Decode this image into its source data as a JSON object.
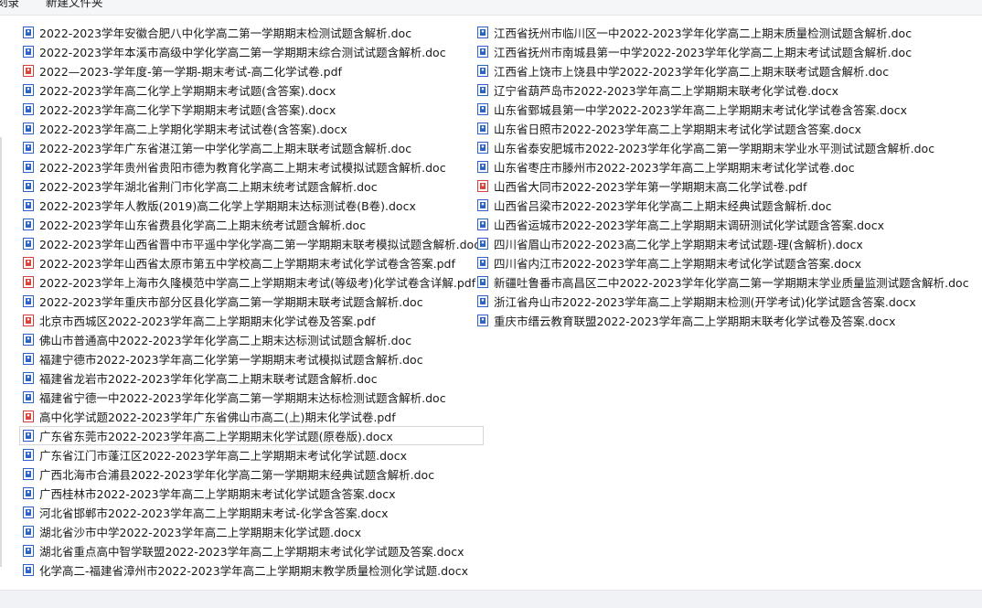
{
  "toolbar": {
    "items": [
      {
        "label": "刻录"
      },
      {
        "label": "新建文件夹"
      }
    ]
  },
  "files": {
    "left": [
      {
        "name": "2022-2023学年安徽合肥八中化学高二第一学期期末检测试题含解析.doc",
        "icon": "word-doc-icon"
      },
      {
        "name": "2022-2023学年本溪市高级中学化学高二第一学期期末综合测试试题含解析.doc",
        "icon": "word-doc-icon"
      },
      {
        "name": "2022—2023-学年度-第一学期-期末考试-高二化学试卷.pdf",
        "icon": "pdf-file-icon"
      },
      {
        "name": "2022-2023学年高二化学上学期期末考试题(含答案).docx",
        "icon": "word-doc-icon"
      },
      {
        "name": "2022-2023学年高二化学下学期期末考试题(含答案).docx",
        "icon": "word-doc-icon"
      },
      {
        "name": "2022-2023学年高二上学期化学期末考试试卷(含答案).docx",
        "icon": "word-doc-icon"
      },
      {
        "name": "2022-2023学年广东省湛江第一中学化学高二上期末联考试题含解析.doc",
        "icon": "word-doc-icon"
      },
      {
        "name": "2022-2023学年贵州省贵阳市德为教育化学高二上期末考试模拟试题含解析.doc",
        "icon": "word-doc-icon"
      },
      {
        "name": "2022-2023学年湖北省荆门市化学高二上期末统考试题含解析.doc",
        "icon": "word-doc-icon"
      },
      {
        "name": "2022-2023学年人教版(2019)高二化学上学期期末达标测试卷(B卷).docx",
        "icon": "word-doc-icon"
      },
      {
        "name": "2022-2023学年山东省费县化学高二上期末统考试题含解析.doc",
        "icon": "word-doc-icon"
      },
      {
        "name": "2022-2023学年山西省晋中市平遥中学化学高二第一学期期末联考模拟试题含解析.doc",
        "icon": "word-doc-icon"
      },
      {
        "name": "2022-2023学年山西省太原市第五中学校高二上学期期末考试化学试卷含答案.pdf",
        "icon": "pdf-file-icon"
      },
      {
        "name": "2022-2023学年上海市久隆模范中学高二上学期期末考试(等级考)化学试卷含详解.pdf",
        "icon": "pdf-file-icon"
      },
      {
        "name": "2022-2023学年重庆市部分区县化学高二第一学期期末联考试题含解析.doc",
        "icon": "word-doc-icon"
      },
      {
        "name": "北京市西城区2022-2023学年高二上学期期末化学试卷及答案.pdf",
        "icon": "pdf-file-icon"
      },
      {
        "name": "佛山市普通高中2022-2023学年化学高二上期末达标测试试题含解析.doc",
        "icon": "word-doc-icon"
      },
      {
        "name": "福建宁德市2022-2023学年高二化学第一学期期末考试模拟试题含解析.doc",
        "icon": "word-doc-icon"
      },
      {
        "name": "福建省龙岩市2022-2023学年化学高二上期末联考试题含解析.doc",
        "icon": "word-doc-icon"
      },
      {
        "name": "福建省宁德一中2022-2023学年化学高二第一学期期末达标检测试题含解析.doc",
        "icon": "word-doc-icon"
      },
      {
        "name": "高中化学试题2022-2023学年广东省佛山市高二(上)期末化学试卷.pdf",
        "icon": "pdf-file-icon"
      },
      {
        "name": "广东省东莞市2022-2023学年高二上学期期末化学试题(原卷版).docx",
        "icon": "word-doc-icon",
        "selected": true
      },
      {
        "name": "广东省江门市蓬江区2022-2023学年高二上学期期末考试化学试题.docx",
        "icon": "word-doc-icon"
      },
      {
        "name": "广西北海市合浦县2022-2023学年化学高二第一学期期末经典试题含解析.doc",
        "icon": "word-doc-icon"
      },
      {
        "name": "广西桂林市2022-2023学年高二上学期期末考试化学试题含答案.docx",
        "icon": "word-doc-icon"
      },
      {
        "name": "河北省邯郸市2022-2023学年高二上学期期末考试-化学含答案.docx",
        "icon": "word-doc-icon"
      },
      {
        "name": "湖北省沙市中学2022-2023学年高二上学期期末化学试题.docx",
        "icon": "word-doc-icon"
      },
      {
        "name": "湖北省重点高中智学联盟2022-2023学年高二上学期期末考试化学试题及答案.docx",
        "icon": "word-doc-icon"
      },
      {
        "name": "化学高二-福建省漳州市2022-2023学年高二上学期期末教学质量检测化学试题.docx",
        "icon": "word-doc-icon"
      }
    ],
    "right": [
      {
        "name": "江西省抚州市临川区一中2022-2023学年化学高二上期末质量检测试题含解析.doc",
        "icon": "word-doc-icon"
      },
      {
        "name": "江西省抚州市南城县第一中学2022-2023学年化学高二上期末考试试题含解析.doc",
        "icon": "word-doc-icon"
      },
      {
        "name": "江西省上饶市上饶县中学2022-2023学年化学高二上期末联考试题含解析.doc",
        "icon": "word-doc-icon"
      },
      {
        "name": "辽宁省葫芦岛市2022-2023学年高二上学期期末联考化学试卷.docx",
        "icon": "word-doc-icon"
      },
      {
        "name": "山东省鄄城县第一中学2022-2023学年高二上学期期末考试化学试卷含答案.docx",
        "icon": "word-doc-icon"
      },
      {
        "name": "山东省日照市2022-2023学年高二上学期期末考试化学试题含答案.docx",
        "icon": "word-doc-icon"
      },
      {
        "name": "山东省泰安肥城市2022-2023学年化学高二第一学期期末学业水平测试试题含解析.doc",
        "icon": "word-doc-icon"
      },
      {
        "name": "山东省枣庄市滕州市2022-2023学年高二上学期期末考试化学试卷.doc",
        "icon": "word-doc-icon"
      },
      {
        "name": "山西省大同市2022-2023学年第一学期期末高二化学试卷.pdf",
        "icon": "pdf-file-icon"
      },
      {
        "name": "山西省吕梁市2022-2023学年化学高二上期末经典试题含解析.doc",
        "icon": "word-doc-icon"
      },
      {
        "name": "山西省运城市2022-2023学年高二上学期期末调研测试化学试题含答案.docx",
        "icon": "word-doc-icon"
      },
      {
        "name": "四川省眉山市2022-2023高二化学上学期期末考试试题-理(含解析).docx",
        "icon": "word-doc-icon"
      },
      {
        "name": "四川省内江市2022-2023学年高二上学期期末考试化学试题含答案.docx",
        "icon": "word-doc-icon"
      },
      {
        "name": "新疆吐鲁番市高昌区二中2022-2023学年化学高二第一学期期末学业质量监测试题含解析.doc",
        "icon": "word-doc-icon"
      },
      {
        "name": "浙江省舟山市2022-2023学年高二上学期期末检测(开学考试)化学试题含答案.docx",
        "icon": "word-doc-icon"
      },
      {
        "name": "重庆市缙云教育联盟2022-2023学年高二上学期期末联考化学试卷及答案.docx",
        "icon": "word-doc-icon"
      }
    ]
  }
}
